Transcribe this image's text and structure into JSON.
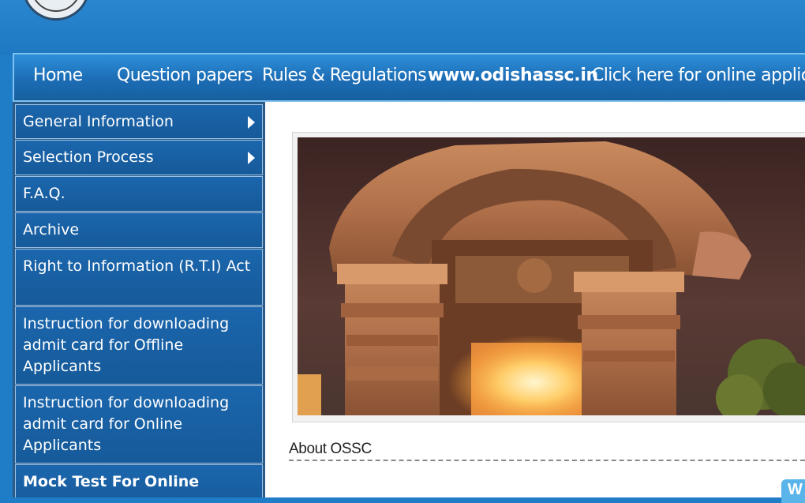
{
  "topnav": {
    "items": [
      "Home",
      "Question papers",
      "Rules & Regulations",
      "www.odishassc.in",
      "Click here for online applic"
    ]
  },
  "sidebar": {
    "items": [
      {
        "label": "General Information",
        "has_submenu": true
      },
      {
        "label": "Selection Process",
        "has_submenu": true
      },
      {
        "label": "F.A.Q."
      },
      {
        "label": "Archive"
      },
      {
        "label": "Right to Information (R.T.I) Act"
      },
      {
        "label": "Instruction for downloading admit card for Offline Applicants"
      },
      {
        "label": "Instruction for downloading admit card for Online Applicants"
      },
      {
        "label": "Mock Test For Online"
      }
    ]
  },
  "main": {
    "about_heading": "About OSSC",
    "corner_text": "W"
  },
  "colors": {
    "nav_blue": "#1c6db5",
    "sidebar_blue": "#1b66ad",
    "header_blue": "#2a86cf",
    "accent_light_blue": "#58b4e9"
  }
}
